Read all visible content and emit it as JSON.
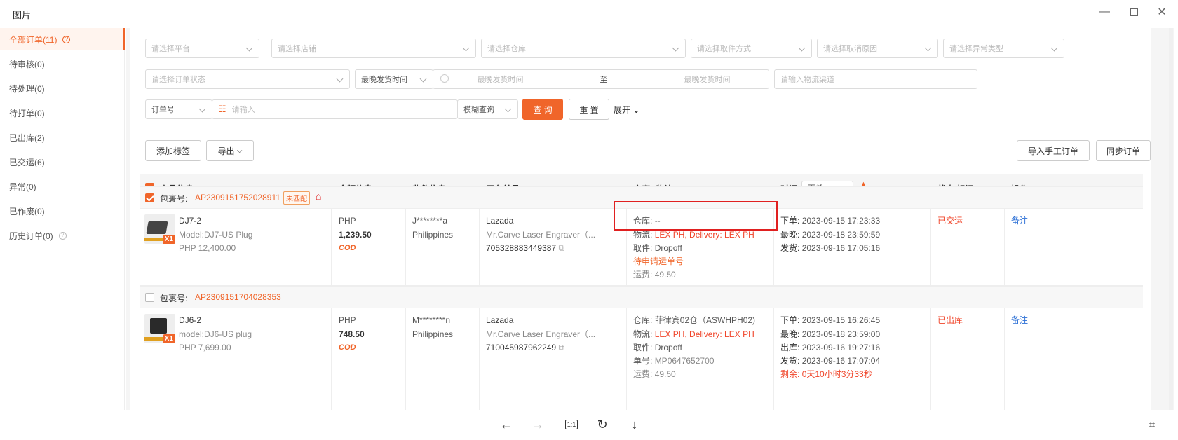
{
  "window": {
    "title": "图片"
  },
  "sidebar": {
    "items": [
      {
        "label": "全部订单(11)"
      },
      {
        "label": "待审核(0)"
      },
      {
        "label": "待处理(0)"
      },
      {
        "label": "待打单(0)"
      },
      {
        "label": "已出库(2)"
      },
      {
        "label": "已交运(6)"
      },
      {
        "label": "异常(0)"
      },
      {
        "label": "已作废(0)"
      },
      {
        "label": "历史订单(0)"
      }
    ]
  },
  "filters": {
    "platform": "请选择平台",
    "store": "请选择店铺",
    "warehouse": "请选择仓库",
    "pickup": "请选择取件方式",
    "cancel_reason": "请选择取消原因",
    "exception_type": "请选择异常类型",
    "order_status": "请选择订单状态",
    "time_type": "最晚发货时间",
    "start_time": "最晚发货时间",
    "to": "至",
    "end_time": "最晚发货时间",
    "channel": "请输入物流渠道",
    "order_field": "订单号",
    "search_placeholder": "请输入",
    "match_mode": "模糊查询",
    "query_btn": "查 询",
    "reset_btn": "重 置",
    "expand": "展开"
  },
  "toolbar": {
    "add_tag": "添加标签",
    "export": "导出",
    "import_manual": "导入手工订单",
    "sync": "同步订单"
  },
  "table": {
    "headers": {
      "product": "商品信息",
      "amount": "金额信息",
      "receiver": "收件信息",
      "platform_no": "平台单号",
      "warehouse": "仓库&物流",
      "time": "时间",
      "time_sort": "下单",
      "status": "状态/标记",
      "action": "操作"
    },
    "orders": [
      {
        "pkg_label": "包裹号:",
        "pkg_no": "AP2309151752028911",
        "tag": "未匹配",
        "sku": "DJ7-2",
        "model": "Model:DJ7-US Plug",
        "price": "PHP 12,400.00",
        "qty": "X1",
        "currency": "PHP",
        "amount": "1,239.50",
        "cod": "COD",
        "receiver": "J********a",
        "country": "Philippines",
        "platform": "Lazada",
        "shop": "Mr.Carve Laser Engraver（...",
        "platform_no": "705328883449387",
        "wh_label": "仓库:",
        "wh_value": "--",
        "ship_label": "物流:",
        "ship_value": "LEX PH, Delivery: LEX PH",
        "pick_label": "取件:",
        "pick_value": "Dropoff",
        "pending": "待申请运单号",
        "fee_label": "运费:",
        "fee_value": "49.50",
        "t1_label": "下单:",
        "t1": "2023-09-15 17:23:33",
        "t2_label": "最晚:",
        "t2": "2023-09-18 23:59:59",
        "t3_label": "发货:",
        "t3": "2023-09-16 17:05:16",
        "status": "已交运",
        "action": "备注"
      },
      {
        "pkg_label": "包裹号:",
        "pkg_no": "AP2309151704028353",
        "sku": "DJ6-2",
        "model": "model:DJ6-US plug",
        "price": "PHP 7,699.00",
        "qty": "X1",
        "currency": "PHP",
        "amount": "748.50",
        "cod": "COD",
        "receiver": "M********n",
        "country": "Philippines",
        "platform": "Lazada",
        "shop": "Mr.Carve Laser Engraver（...",
        "platform_no": "710045987962249",
        "wh_label": "仓库:",
        "wh_value": "菲律宾02仓（ASWHPH02)",
        "ship_label": "物流:",
        "ship_value": "LEX PH, Delivery: LEX PH",
        "pick_label": "取件:",
        "pick_value": "Dropoff",
        "no_label": "单号:",
        "no_value": "MP0647652700",
        "fee_label": "运费:",
        "fee_value": "49.50",
        "t1_label": "下单:",
        "t1": "2023-09-15 16:26:45",
        "t2_label": "最晚:",
        "t2": "2023-09-18 23:59:00",
        "t3_label": "出库:",
        "t3": "2023-09-16 19:27:16",
        "t4_label": "发货:",
        "t4": "2023-09-16 17:07:04",
        "t5_label": "剩余:",
        "t5": "0天10小时3分33秒",
        "status": "已出库",
        "action": "备注"
      }
    ]
  },
  "viewer": {
    "ratio": "1:1"
  },
  "colors": {
    "accent": "#f0652a",
    "highlight_box": "#e02020",
    "link": "#2b6fd6"
  }
}
